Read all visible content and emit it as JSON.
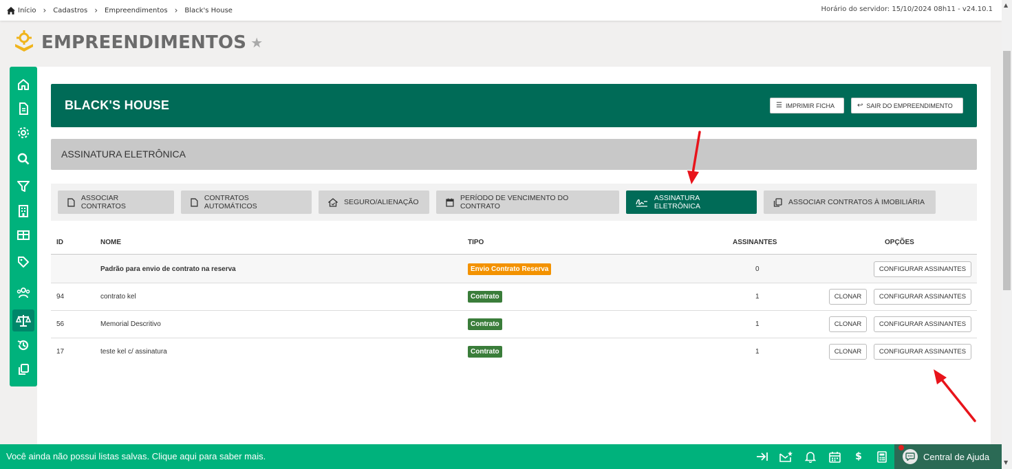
{
  "breadcrumb": {
    "items": [
      "Início",
      "Cadastros",
      "Empreendimentos",
      "Black's House"
    ],
    "server_time": "Horário do servidor: 15/10/2024 08h11 - v24.10.1"
  },
  "page": {
    "title": "EMPREENDIMENTOS"
  },
  "sidebar": {
    "items": [
      "home-icon",
      "document-icon",
      "gear-icon",
      "search-icon",
      "filter-icon",
      "building-icon",
      "table-icon",
      "tag-icon",
      "users-icon",
      "scale-icon",
      "history-icon",
      "copy-icon"
    ],
    "active": "scale-icon"
  },
  "empreendimento": {
    "name": "BLACK'S HOUSE",
    "print_label": "IMPRIMIR FICHA",
    "exit_label": "SAIR DO EMPREENDIMENTO"
  },
  "section": {
    "title": "ASSINATURA ELETRÔNICA"
  },
  "tabs": [
    {
      "label": "ASSOCIAR CONTRATOS",
      "icon": "document-icon",
      "active": false
    },
    {
      "label": "CONTRATOS AUTOMÁTICOS",
      "icon": "document-icon",
      "active": false
    },
    {
      "label": "SEGURO/ALIENAÇÃO",
      "icon": "house-icon",
      "active": false
    },
    {
      "label": "PERÍODO DE VENCIMENTO DO CONTRATO",
      "icon": "calendar-icon",
      "active": false
    },
    {
      "label": "ASSINATURA ELETRÔNICA",
      "icon": "signature-icon",
      "active": true
    },
    {
      "label": "ASSOCIAR CONTRATOS À IMOBILIÁRIA",
      "icon": "copy-icon",
      "active": false
    }
  ],
  "table": {
    "headers": {
      "id": "ID",
      "nome": "NOME",
      "tipo": "TIPO",
      "assinantes": "ASSINANTES",
      "opcoes": "OPÇÕES"
    },
    "clone_label": "CLONAR",
    "configure_label": "CONFIGURAR ASSINANTES",
    "rows": [
      {
        "id": "",
        "nome": "Padrão para envio de contrato na reserva",
        "tipo": "Envio Contrato Reserva",
        "assinantes": "0"
      },
      {
        "id": "94",
        "nome": "contrato kel",
        "tipo": "Contrato",
        "assinantes": "1"
      },
      {
        "id": "56",
        "nome": "Memorial Descritivo",
        "tipo": "Contrato",
        "assinantes": "1"
      },
      {
        "id": "17",
        "nome": "teste kel c/ assinatura",
        "tipo": "Contrato",
        "assinantes": "1"
      }
    ]
  },
  "bottom": {
    "message": "Você ainda não possui listas salvas. Clique aqui para saber mais.",
    "help_label": "Central de Ajuda",
    "icons": [
      "arrow-to-right-icon",
      "mail-star-icon",
      "bell-icon",
      "calendar-icon",
      "dollar-icon",
      "calculator-icon"
    ]
  },
  "colors": {
    "brand_green": "#00b27c",
    "dark_green": "#006b57",
    "badge_orange": "#f39200",
    "badge_green": "#3a7d3a",
    "annotation_red": "#e8141b"
  }
}
